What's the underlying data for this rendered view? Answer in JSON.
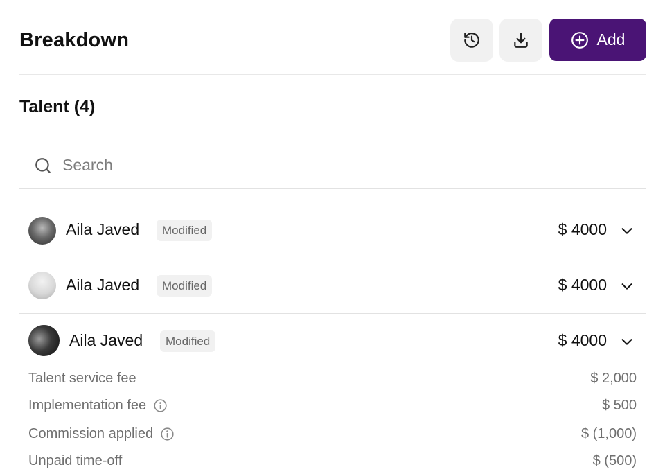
{
  "header": {
    "title": "Breakdown",
    "add_label": "Add",
    "accent_color": "#4a1475"
  },
  "section": {
    "title": "Talent (4)"
  },
  "search": {
    "placeholder": "Search",
    "value": ""
  },
  "talent": [
    {
      "name": "Aila Javed",
      "badge": "Modified",
      "amount": "$ 4000",
      "expanded": false
    },
    {
      "name": "Aila Javed",
      "badge": "Modified",
      "amount": "$ 4000",
      "expanded": false
    },
    {
      "name": "Aila Javed",
      "badge": "Modified",
      "amount": "$ 4000",
      "expanded": true
    }
  ],
  "details": [
    {
      "label": "Talent service fee",
      "value": "$ 2,000",
      "info": false
    },
    {
      "label": "Implementation fee",
      "value": "$ 500",
      "info": true
    },
    {
      "label": "Commission applied",
      "value": "$ (1,000)",
      "info": true
    },
    {
      "label": "Unpaid time-off",
      "value": "$ (500)",
      "info": false
    }
  ],
  "icons": {
    "history": "history-icon",
    "download": "download-icon",
    "add": "plus-circle-icon",
    "search": "search-icon",
    "chevron": "chevron-down-icon",
    "info": "info-icon"
  }
}
